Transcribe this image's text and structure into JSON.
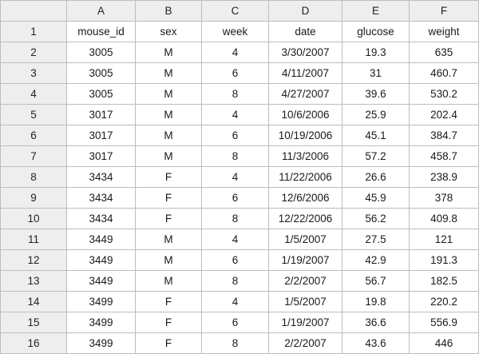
{
  "columns": [
    "A",
    "B",
    "C",
    "D",
    "E",
    "F"
  ],
  "rows": [
    {
      "num": "1",
      "cells": [
        "mouse_id",
        "sex",
        "week",
        "date",
        "glucose",
        "weight"
      ]
    },
    {
      "num": "2",
      "cells": [
        "3005",
        "M",
        "4",
        "3/30/2007",
        "19.3",
        "635"
      ]
    },
    {
      "num": "3",
      "cells": [
        "3005",
        "M",
        "6",
        "4/11/2007",
        "31",
        "460.7"
      ]
    },
    {
      "num": "4",
      "cells": [
        "3005",
        "M",
        "8",
        "4/27/2007",
        "39.6",
        "530.2"
      ]
    },
    {
      "num": "5",
      "cells": [
        "3017",
        "M",
        "4",
        "10/6/2006",
        "25.9",
        "202.4"
      ]
    },
    {
      "num": "6",
      "cells": [
        "3017",
        "M",
        "6",
        "10/19/2006",
        "45.1",
        "384.7"
      ]
    },
    {
      "num": "7",
      "cells": [
        "3017",
        "M",
        "8",
        "11/3/2006",
        "57.2",
        "458.7"
      ]
    },
    {
      "num": "8",
      "cells": [
        "3434",
        "F",
        "4",
        "11/22/2006",
        "26.6",
        "238.9"
      ]
    },
    {
      "num": "9",
      "cells": [
        "3434",
        "F",
        "6",
        "12/6/2006",
        "45.9",
        "378"
      ]
    },
    {
      "num": "10",
      "cells": [
        "3434",
        "F",
        "8",
        "12/22/2006",
        "56.2",
        "409.8"
      ]
    },
    {
      "num": "11",
      "cells": [
        "3449",
        "M",
        "4",
        "1/5/2007",
        "27.5",
        "121"
      ]
    },
    {
      "num": "12",
      "cells": [
        "3449",
        "M",
        "6",
        "1/19/2007",
        "42.9",
        "191.3"
      ]
    },
    {
      "num": "13",
      "cells": [
        "3449",
        "M",
        "8",
        "2/2/2007",
        "56.7",
        "182.5"
      ]
    },
    {
      "num": "14",
      "cells": [
        "3499",
        "F",
        "4",
        "1/5/2007",
        "19.8",
        "220.2"
      ]
    },
    {
      "num": "15",
      "cells": [
        "3499",
        "F",
        "6",
        "1/19/2007",
        "36.6",
        "556.9"
      ]
    },
    {
      "num": "16",
      "cells": [
        "3499",
        "F",
        "8",
        "2/2/2007",
        "43.6",
        "446"
      ]
    }
  ]
}
